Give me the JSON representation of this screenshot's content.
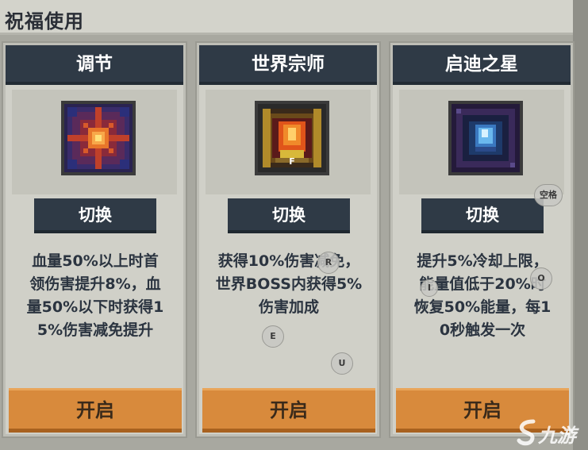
{
  "title": "祝福使用",
  "cards": [
    {
      "name": "调节",
      "switch_label": "切换",
      "description": [
        "血量50%以上时首",
        "领伤害提升8%，血",
        "量50%以下时获得1",
        "5%伤害减免提升"
      ],
      "action_label": "开启",
      "icon": "sun-burst-icon",
      "accent": "#e8762a"
    },
    {
      "name": "世界宗师",
      "switch_label": "切换",
      "description": [
        "获得10%伤害减免，",
        "世界BOSS内获得5%",
        "伤害加成"
      ],
      "action_label": "开启",
      "icon": "fire-crest-icon",
      "icon_key": "F",
      "accent": "#e0541a"
    },
    {
      "name": "启迪之星",
      "switch_label": "切换",
      "description": [
        "提升5%冷却上限，",
        "能量值低于20%时",
        "恢复50%能量，每1",
        "0秒触发一次"
      ],
      "action_label": "开启",
      "icon": "crystal-star-icon",
      "accent": "#6ab8ee"
    }
  ],
  "key_hints": {
    "space": "空格",
    "r": "R",
    "e": "E",
    "u": "U",
    "o": "O",
    "i": "I"
  },
  "watermark": "九游",
  "colors": {
    "header_bg": "#2f3a46",
    "open_btn": "#d88a3c",
    "card_bg": "#d0d0c8"
  }
}
